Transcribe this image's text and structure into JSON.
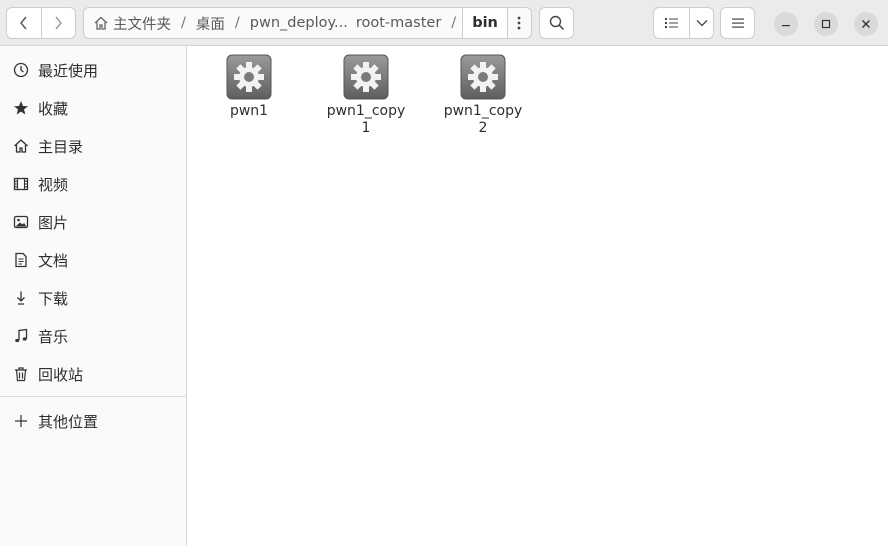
{
  "path": {
    "segments": [
      "主文件夹",
      "桌面",
      "pwn_deploy...",
      "root-master",
      "bin"
    ]
  },
  "sidebar": {
    "items": [
      {
        "label": "最近使用",
        "icon": "clock-icon"
      },
      {
        "label": "收藏",
        "icon": "star-icon"
      },
      {
        "label": "主目录",
        "icon": "home-icon"
      },
      {
        "label": "视频",
        "icon": "film-icon"
      },
      {
        "label": "图片",
        "icon": "picture-icon"
      },
      {
        "label": "文档",
        "icon": "document-icon"
      },
      {
        "label": "下载",
        "icon": "download-icon"
      },
      {
        "label": "音乐",
        "icon": "music-icon"
      },
      {
        "label": "回收站",
        "icon": "trash-icon"
      }
    ],
    "other": {
      "label": "其他位置",
      "icon": "plus-icon"
    }
  },
  "files": [
    {
      "name": "pwn1",
      "icon": "executable-gear-icon"
    },
    {
      "name": "pwn1_copy1",
      "icon": "executable-gear-icon"
    },
    {
      "name": "pwn1_copy2",
      "icon": "executable-gear-icon"
    }
  ]
}
